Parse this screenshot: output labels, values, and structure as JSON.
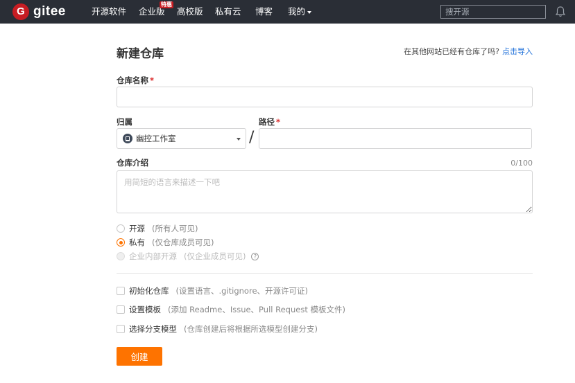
{
  "header": {
    "logo_letter": "G",
    "logo_text": "gitee",
    "nav": [
      {
        "label": "开源软件"
      },
      {
        "label": "企业版"
      },
      {
        "label": "高校版"
      },
      {
        "label": "私有云"
      },
      {
        "label": "博客"
      },
      {
        "label": "我的"
      }
    ],
    "badge": "特惠",
    "search_placeholder": "搜开源",
    "bell_icon": "bell-icon"
  },
  "form": {
    "title": "新建仓库",
    "import_hint": "在其他网站已经有仓库了吗?",
    "import_link": "点击导入",
    "name_label": "仓库名称",
    "required_mark": "*",
    "owner_label": "归属",
    "owner_value": "幽控工作室",
    "path_label": "路径",
    "slash": "/",
    "desc_label": "仓库介绍",
    "desc_counter": "0/100",
    "desc_placeholder": "用简短的语言来描述一下吧",
    "visibility": [
      {
        "label": "开源",
        "note": "(所有人可见)",
        "checked": false,
        "disabled": false
      },
      {
        "label": "私有",
        "note": "(仅仓库成员可见)",
        "checked": true,
        "disabled": false
      },
      {
        "label": "企业内部开源",
        "note": "(仅企业成员可见)",
        "checked": false,
        "disabled": true
      }
    ],
    "help_glyph": "?",
    "options": [
      {
        "label": "初始化仓库",
        "note": "(设置语言、.gitignore、开源许可证)",
        "checked": false
      },
      {
        "label": "设置模板",
        "note": "(添加 Readme、Issue、Pull Request 模板文件)",
        "checked": false
      },
      {
        "label": "选择分支模型",
        "note": "(仓库创建后将根据所选模型创建分支)",
        "checked": false
      }
    ],
    "submit_label": "创建"
  },
  "colors": {
    "topbar": "#2a2e36",
    "brand": "#c71d23",
    "accent": "#fe7300",
    "link": "#1e6fd9"
  }
}
